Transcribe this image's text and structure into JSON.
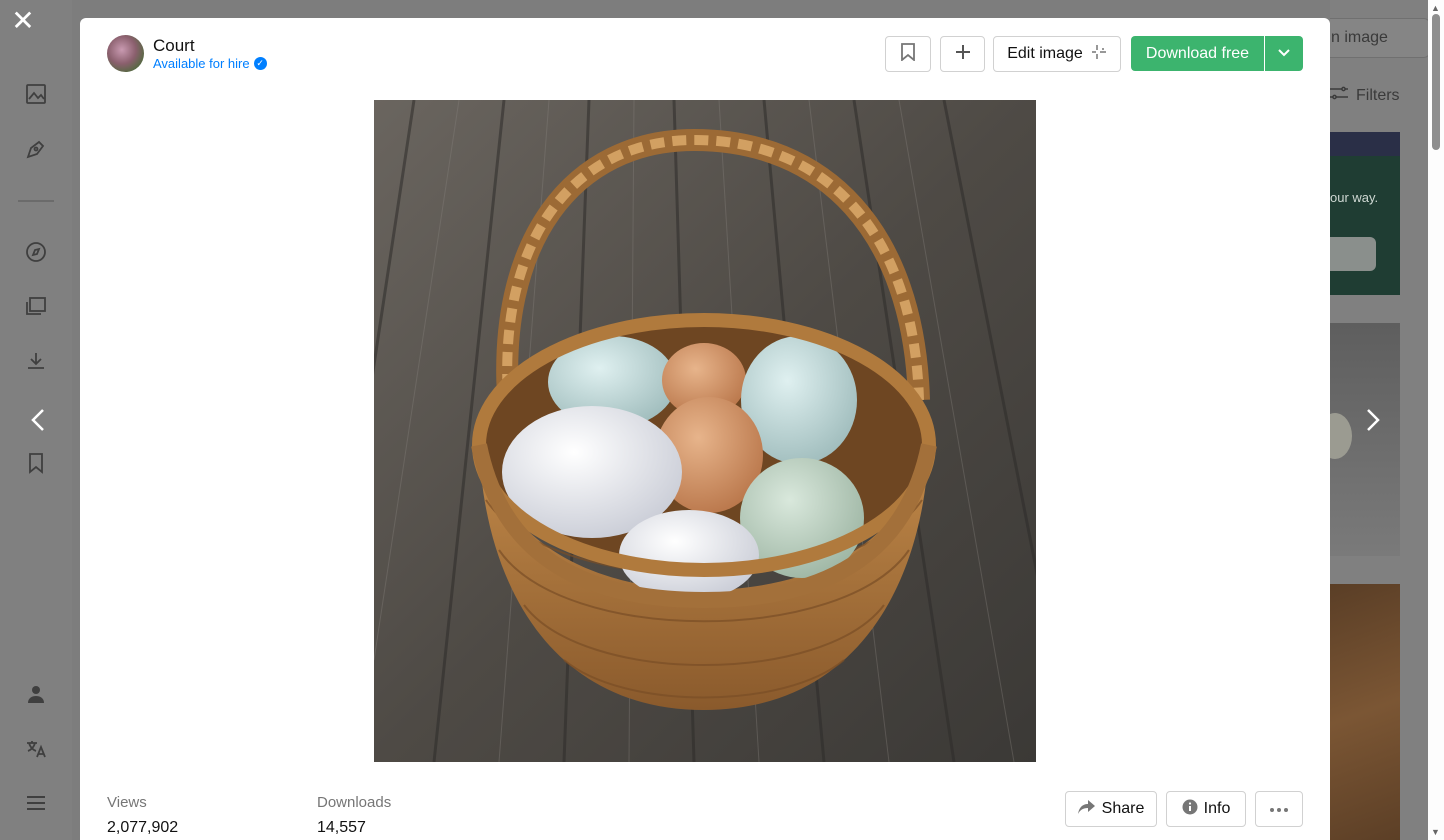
{
  "background": {
    "search_button_partial": "n image",
    "filters_label": "Filters",
    "banner_text_partial": "our way."
  },
  "user": {
    "name": "Court",
    "hire_status": "Available for hire"
  },
  "toolbar": {
    "edit_image_label": "Edit image",
    "download_label": "Download free"
  },
  "stats": {
    "views_label": "Views",
    "views_value": "2,077,902",
    "downloads_label": "Downloads",
    "downloads_value": "14,557"
  },
  "actions": {
    "share_label": "Share",
    "info_label": "Info"
  },
  "colors": {
    "accent_green": "#3cb46e",
    "link_blue": "#007fff"
  },
  "icons": [
    "close-icon",
    "chevron-left-icon",
    "chevron-right-icon",
    "bookmark-icon",
    "plus-icon",
    "sparkle-icon",
    "chevron-down-icon",
    "share-icon",
    "info-icon",
    "more-icon"
  ]
}
